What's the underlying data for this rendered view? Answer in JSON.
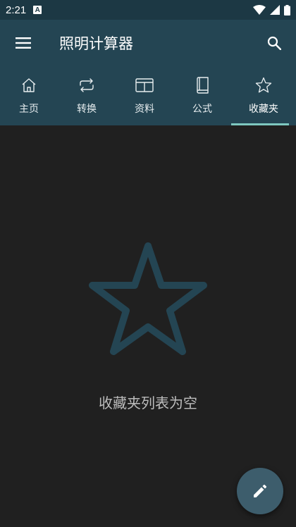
{
  "status_bar": {
    "time": "2:21",
    "badge_letter": "A",
    "icons": [
      "wifi-icon",
      "signal-icon",
      "battery-icon"
    ]
  },
  "app_bar": {
    "title": "照明计算器",
    "icons": [
      "menu-icon",
      "search-icon"
    ]
  },
  "tabs": [
    {
      "label": "主页",
      "icon": "home-icon"
    },
    {
      "label": "转换",
      "icon": "repeat-icon"
    },
    {
      "label": "资料",
      "icon": "panel-icon"
    },
    {
      "label": "公式",
      "icon": "book-icon"
    },
    {
      "label": "收藏夹",
      "icon": "star-icon"
    }
  ],
  "active_tab": "收藏夹",
  "empty_state": {
    "message": "收藏夹列表为空",
    "icon": "star-outline-icon"
  },
  "fab": {
    "icon": "pencil-icon"
  },
  "colors": {
    "status_bar": "#1c3844",
    "app_bar": "#244553",
    "background": "#202020",
    "indicator": "#7ec8c0",
    "fab": "#3d5d6c",
    "empty_star": "#244553"
  }
}
